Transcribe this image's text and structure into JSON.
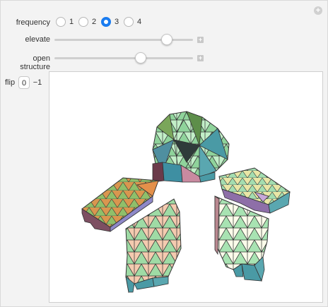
{
  "controls": {
    "frequency_label": "frequency",
    "frequency_options": [
      "1",
      "2",
      "3",
      "4"
    ],
    "frequency_selected": "3",
    "elevate_label": "elevate",
    "elevate_value": 0.81,
    "open_structure_label": "open structure",
    "open_structure_value": 0.62,
    "flip_label": "flip",
    "flip_options": [
      "0",
      "−1"
    ],
    "flip_selected": "0"
  },
  "icons": {
    "panel_options": "plus-circle-icon",
    "slider_expand": "plus-icon"
  },
  "colors": {
    "radio_accent": "#1a7cf0",
    "face_green": "#9fe0a8",
    "face_peach": "#f1c1a6",
    "face_teal": "#4a9aa5",
    "face_cream": "#fafbe6",
    "face_purple": "#8e6fa8",
    "face_orange": "#d98a4a"
  }
}
